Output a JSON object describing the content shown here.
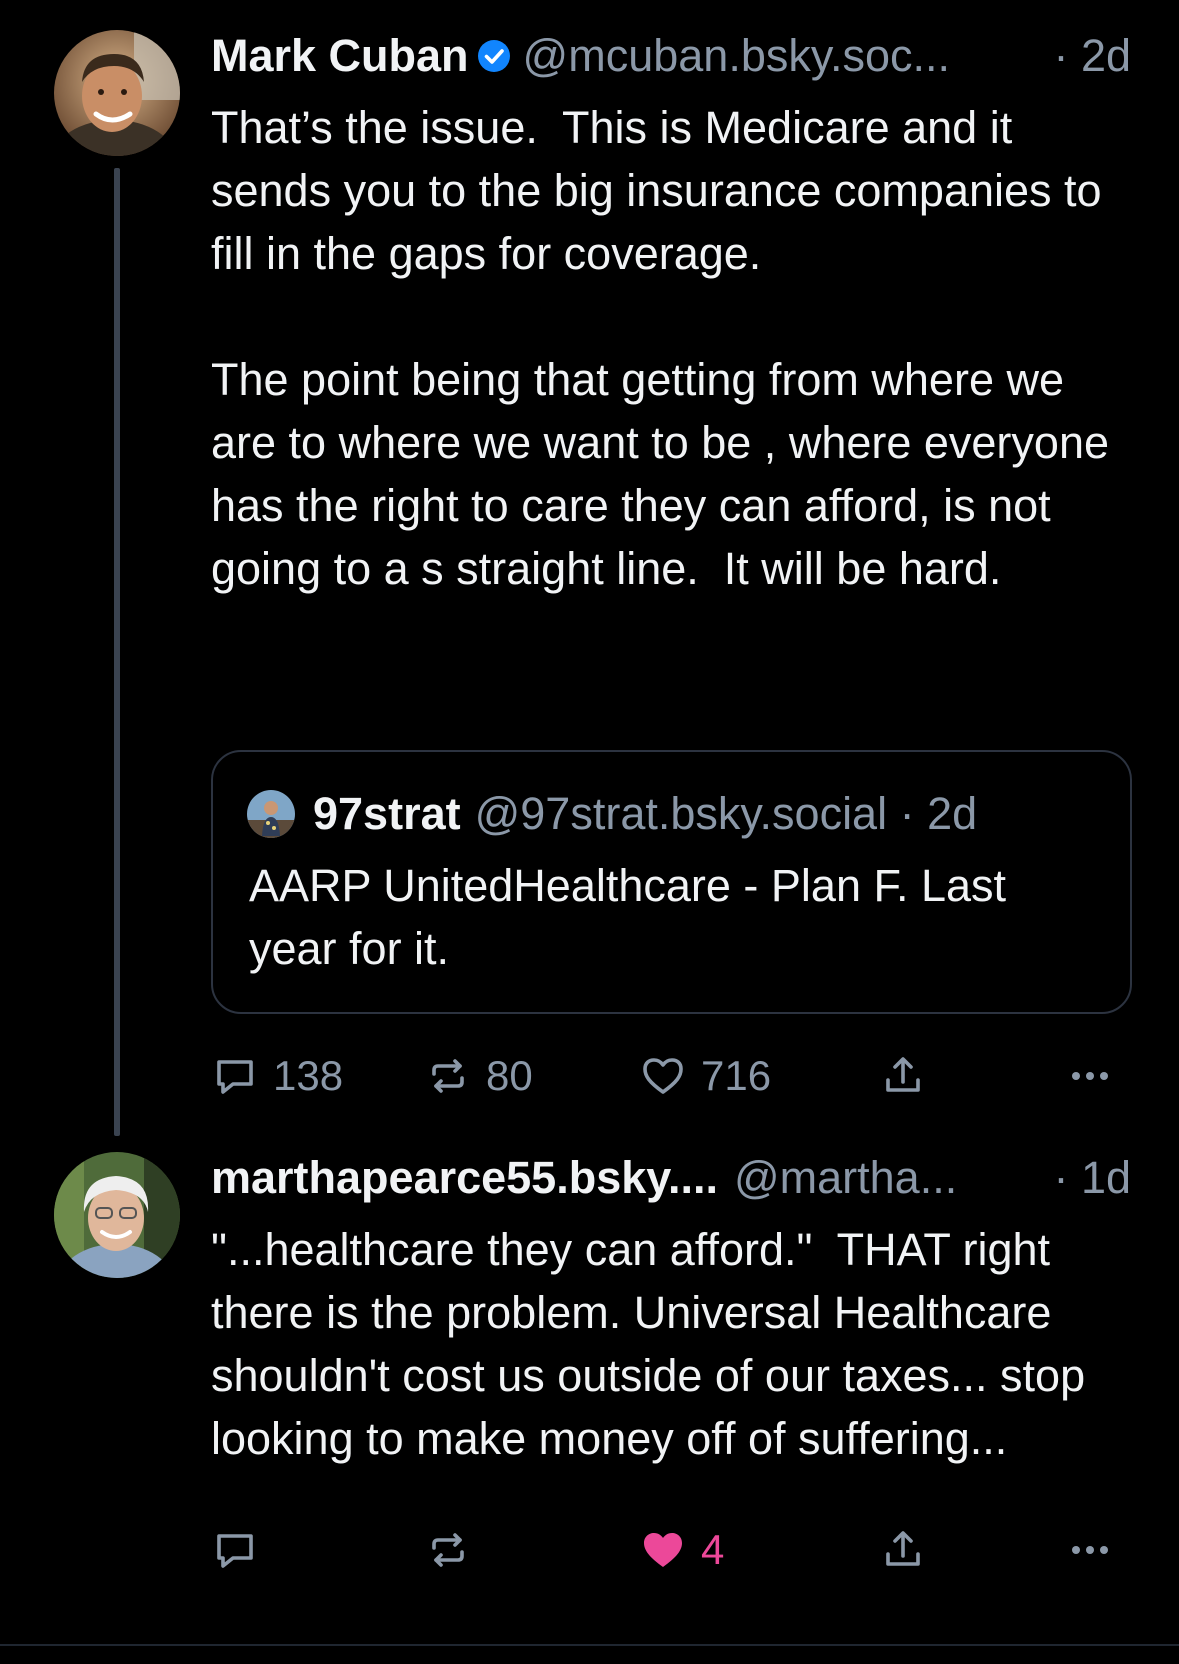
{
  "colors": {
    "background": "#000000",
    "text": "#f1f3f5",
    "muted": "#8b98a8",
    "verified": "#1185fe",
    "like_active": "#ec4899",
    "thread_line": "#3a4350"
  },
  "posts": [
    {
      "display_name": "Mark Cuban",
      "verified": true,
      "handle": "@mcuban.bsky.soc...",
      "time": "· 2d",
      "text": "That’s the issue.  This is Medicare and it sends you to the big insurance companies to fill in the gaps for coverage.\n\nThe point being that getting from where we are to where we want to be , where everyone has the right to care they can afford, is not going to a s straight line.  It will be hard.",
      "quote": {
        "display_name": "97strat",
        "handle": "@97strat.bsky.social · 2d",
        "text": "AARP UnitedHealthcare - Plan F. Last year for it."
      },
      "actions": {
        "reply_icon": "speech-bubble-icon",
        "reply_count": "138",
        "repost_icon": "repost-arrows-icon",
        "repost_count": "80",
        "like_icon": "heart-outline-icon",
        "like_count": "716",
        "share_icon": "share-upload-icon",
        "more_icon": "more-dots-icon"
      }
    },
    {
      "display_name": "marthapearce55.bsky....",
      "verified": false,
      "handle": "@martha...",
      "time": "· 1d",
      "text": "\"...healthcare they can afford.\"  THAT right there is the problem. Universal Healthcare shouldn't cost us outside of our taxes... stop looking to make money off of suffering...",
      "actions": {
        "reply_icon": "speech-bubble-icon",
        "repost_icon": "repost-arrows-icon",
        "like_icon": "heart-filled-icon",
        "like_count": "4",
        "liked": true,
        "share_icon": "share-upload-icon",
        "more_icon": "more-dots-icon"
      }
    }
  ]
}
